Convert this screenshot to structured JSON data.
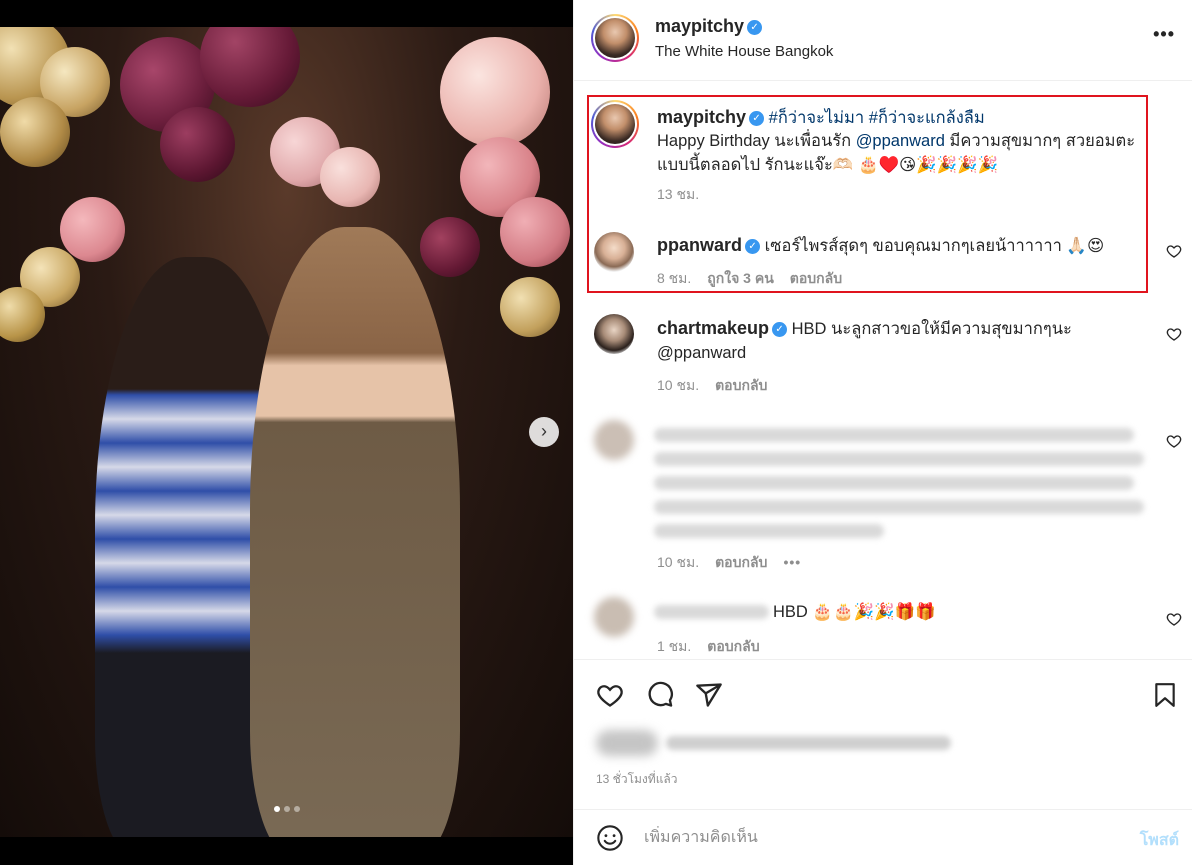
{
  "post": {
    "author": "maypitchy",
    "location": "The White House Bangkok",
    "more_label": "•••"
  },
  "caption": {
    "author": "maypitchy",
    "hashtags": "#ก็ว่าจะไม่มา #ก็ว่าจะแกล้งลืม",
    "line1_prefix": "Happy Birthday นะเพื่อนรัก ",
    "mention": "@ppanward",
    "line1_suffix": " มีความสุขมากๆ สวยอมตะ",
    "line2": "แบบนี้ตลอดไป รักนะแจ๊ะ🫶🏻 🎂♥️😘🎉🎉🎉🎉",
    "time": "13 ชม."
  },
  "reply": {
    "author": "ppanward",
    "text": "เซอร์ไพรส์สุดๆ ขอบคุณมากๆเลยน้าาาาาา 🙏🏻😍",
    "time": "8 ชม.",
    "likes": "ถูกใจ 3 คน",
    "reply_label": "ตอบกลับ"
  },
  "comments": [
    {
      "author": "chartmakeup",
      "text": "HBD นะลูกสาวขอให้มีความสุขมากๆนะ",
      "mention": "@ppanward",
      "time": "10 ชม.",
      "reply_label": "ตอบกลับ"
    },
    {
      "author": "",
      "text": "",
      "time": "10 ชม.",
      "reply_label": "ตอบกลับ",
      "more_label": "•••"
    },
    {
      "author": "",
      "text": "HBD 🎂🎂🎉🎉🎁🎁",
      "time": "1 ชม.",
      "reply_label": "ตอบกลับ"
    }
  ],
  "actions": {
    "like_icon": "heart-outline",
    "comment_icon": "speech-bubble",
    "share_icon": "paper-plane",
    "save_icon": "bookmark",
    "timestamp": "13 ชั่วโมงที่แล้ว"
  },
  "composer": {
    "placeholder": "เพิ่มความคิดเห็น",
    "post_label": "โพสต์",
    "emoji_icon": "smiley"
  },
  "carousel": {
    "dots": 3,
    "active": 1
  },
  "colors": {
    "highlight": "#e0141e",
    "verified": "#3897f0",
    "link": "#00376b",
    "post_button": "#b2dffc"
  }
}
